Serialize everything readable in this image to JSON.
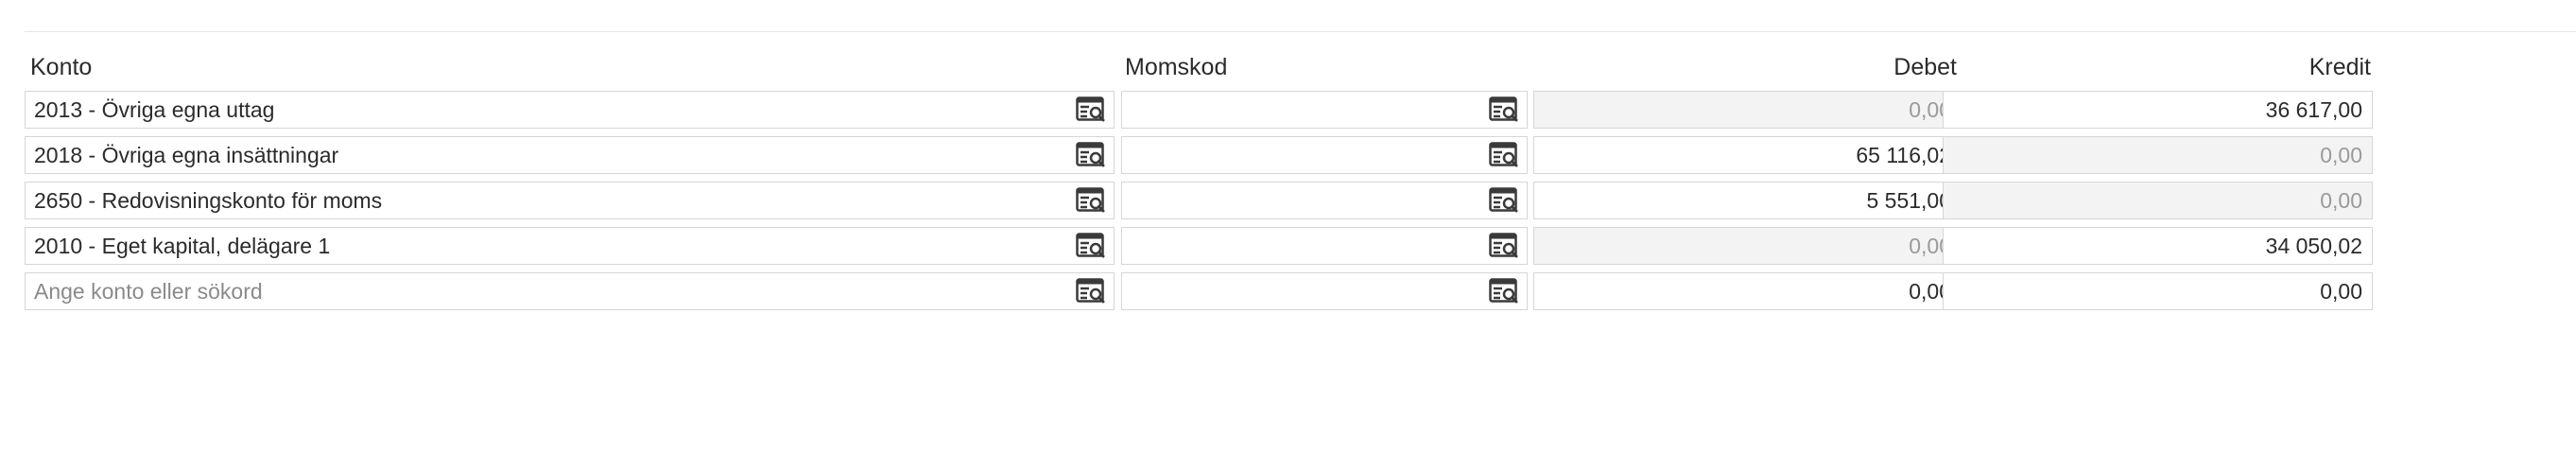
{
  "headers": {
    "konto": "Konto",
    "momskod": "Momskod",
    "debet": "Debet",
    "kredit": "Kredit"
  },
  "rows": [
    {
      "konto": "2013 - Övriga egna uttag",
      "momskod": "",
      "debet": "0,00",
      "kredit": "36 617,00",
      "debet_disabled": true,
      "kredit_disabled": false
    },
    {
      "konto": "2018 - Övriga egna insättningar",
      "momskod": "",
      "debet": "65 116,02",
      "kredit": "0,00",
      "debet_disabled": false,
      "kredit_disabled": true
    },
    {
      "konto": "2650 - Redovisningskonto för moms",
      "momskod": "",
      "debet": "5 551,00",
      "kredit": "0,00",
      "debet_disabled": false,
      "kredit_disabled": true
    },
    {
      "konto": "2010 - Eget kapital, delägare 1",
      "momskod": "",
      "debet": "0,00",
      "kredit": "34 050,02",
      "debet_disabled": true,
      "kredit_disabled": false
    }
  ],
  "new_row": {
    "konto_placeholder": "Ange konto eller sökord",
    "momskod": "",
    "debet": "0,00",
    "kredit": "0,00"
  },
  "icons": {
    "lookup": "list-search-icon"
  },
  "colors": {
    "border": "#d6d6d6",
    "disabled_bg": "#f3f3f3",
    "disabled_text": "#9a9a9a",
    "text": "#2b2b2b"
  }
}
